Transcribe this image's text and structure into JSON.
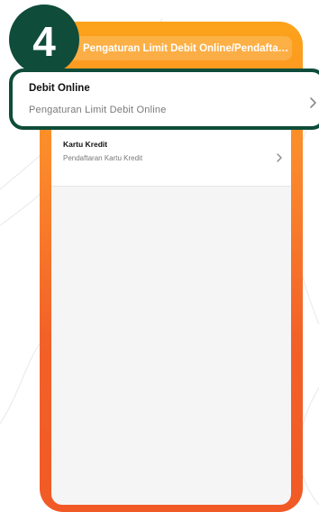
{
  "step": {
    "number": "4"
  },
  "header": {
    "title": "Pengaturan Limit Debit Online/Pendaftara..."
  },
  "menu": {
    "items": [
      {
        "title": "Debit Online",
        "subtitle": "Pengaturan Limit Debit Online",
        "icon": "chevron-right-icon"
      },
      {
        "title": "Kartu Kredit",
        "subtitle": "Pendaftaran Kartu Kredit",
        "icon": "chevron-right-icon"
      }
    ]
  },
  "colors": {
    "accent_dark_green": "#0f4c3a",
    "header_orange_top": "#fca31a",
    "frame_orange_bottom": "#f15a26",
    "screen_bg": "#f5f5f5"
  }
}
